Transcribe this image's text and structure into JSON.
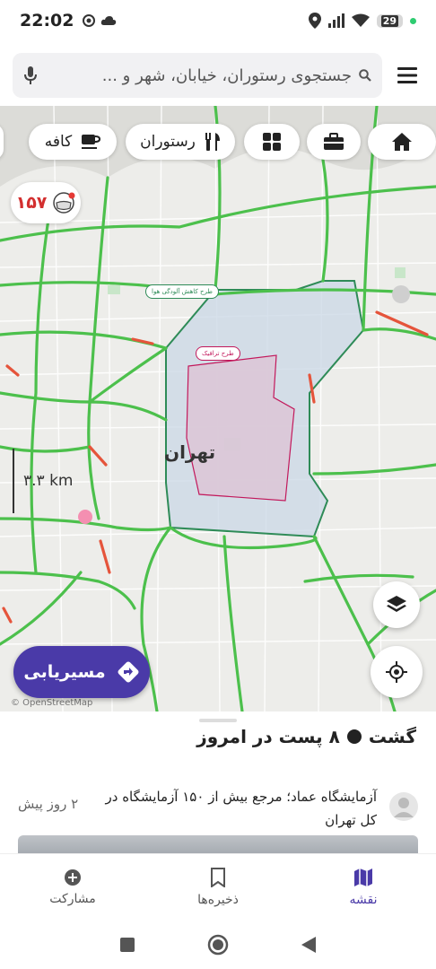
{
  "status_bar": {
    "time": "22:02",
    "battery": "29"
  },
  "search": {
    "placeholder": "جستجوی رستوران، خیابان، شهر و ..."
  },
  "chips": {
    "home": "home-icon",
    "work": "briefcase-icon",
    "categories": "grid-icon",
    "restaurant": "رستوران",
    "cafe": "کافه"
  },
  "air_quality": {
    "value": "۱۵۷"
  },
  "map": {
    "city": "تهران",
    "label_air": "طرح کاهش آلودگی هوا",
    "label_traffic": "طرح ترافیک",
    "scale": "۳.۳ km",
    "route_button": "مسیریابی",
    "attribution": "© OpenStreetMap",
    "colors": {
      "traffic_fast": "#4cc04c",
      "traffic_slow": "#e5543b",
      "accent": "#4a3aa8"
    }
  },
  "feed": {
    "title": "گشت",
    "subtitle": "۸ پست در امروز",
    "post": {
      "text": "آزمایشگاه عماد؛ مرجع بیش از ۱۵۰ آزمایشگاه در کل تهران",
      "time": "۲ روز پیش"
    }
  },
  "nav": {
    "map": "نقشه",
    "saved": "ذخیره‌ها",
    "contribute": "مشارکت"
  }
}
